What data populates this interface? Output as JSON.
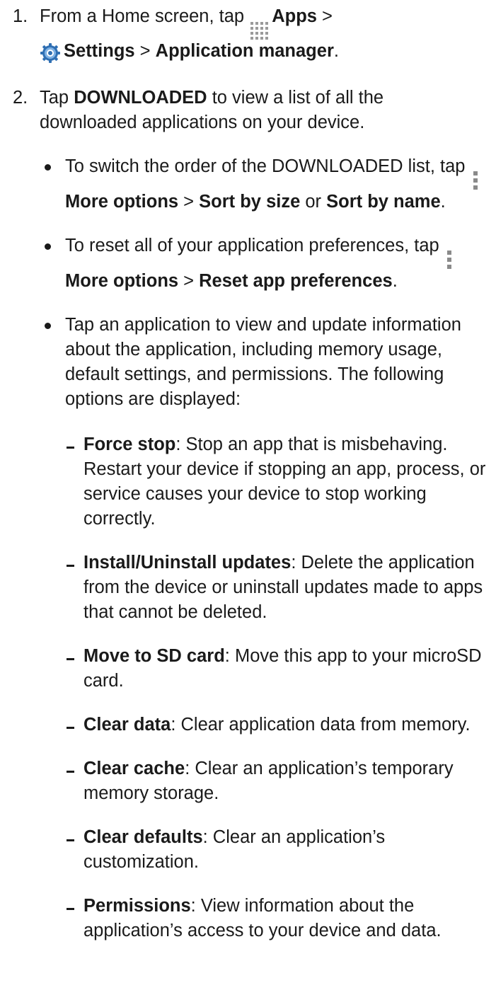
{
  "steps": [
    {
      "num": "1.",
      "pre": "From a Home screen, tap ",
      "apps_label": "Apps",
      "sep1": " > ",
      "settings_label": "Settings",
      "sep2": " > ",
      "app_manager_label": "Application manager",
      "end": "."
    },
    {
      "num": "2.",
      "pre": "Tap ",
      "downloaded_label": "DOWNLOADED",
      "post": " to view a list of all the downloaded applications on your device."
    }
  ],
  "bullets": [
    {
      "pre": "To switch the order of the DOWNLOADED list, tap ",
      "more_options": "More options",
      "sep": " > ",
      "opt1": "Sort by size",
      "or": " or ",
      "opt2": "Sort by name",
      "end": "."
    },
    {
      "pre": "To reset all of your application preferences, tap ",
      "more_options": "More options",
      "sep": " > ",
      "opt1": "Reset app preferences",
      "end": "."
    },
    {
      "text": "Tap an application to view and update information about the application, including memory usage, default settings, and permissions. The following options are displayed:"
    }
  ],
  "options": [
    {
      "term": "Force stop",
      "desc": ": Stop an app that is misbehaving. Restart your device if stopping an app, process, or service causes your device to stop working correctly."
    },
    {
      "term": "Install/Uninstall updates",
      "desc": ": Delete the application from the device or uninstall updates made to apps that cannot be deleted."
    },
    {
      "term": "Move to SD card",
      "desc": ": Move this app to your microSD card."
    },
    {
      "term": "Clear data",
      "desc": ": Clear application data from memory."
    },
    {
      "term": "Clear cache",
      "desc": ": Clear an application’s temporary memory storage."
    },
    {
      "term": "Clear defaults",
      "desc": ": Clear an application’s customization."
    },
    {
      "term": "Permissions",
      "desc": ": View information about the application’s access to your device and data."
    }
  ],
  "icons": {
    "apps": "apps-grid-icon",
    "settings": "settings-gear-icon",
    "more_options": "more-options-icon"
  },
  "colors": {
    "text": "#1a1a1a",
    "icon_gray": "#9a9a9a",
    "settings_blue": "#2f6fb3"
  }
}
